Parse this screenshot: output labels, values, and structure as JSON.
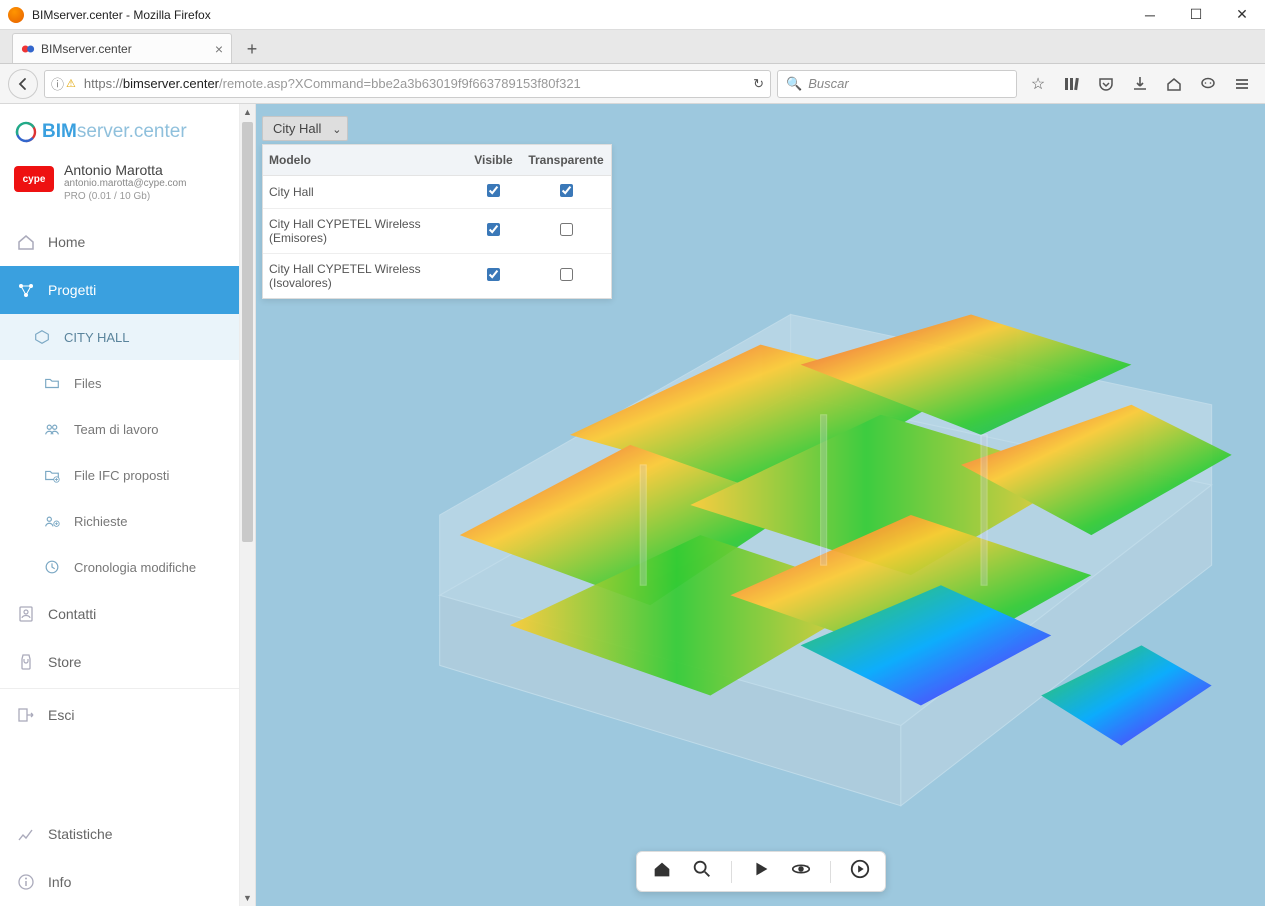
{
  "window": {
    "title": "BIMserver.center - Mozilla Firefox"
  },
  "tab": {
    "label": "BIMserver.center"
  },
  "address": {
    "scheme": "https://",
    "host": "bimserver.center",
    "path": "/remote.asp?XCommand=bbe2a3b63019f9f663789153f80f321"
  },
  "search": {
    "placeholder": "Buscar"
  },
  "brand": {
    "bold": "BIM",
    "rest": "server.center"
  },
  "user": {
    "badge": "cype",
    "name": "Antonio Marotta",
    "email": "antonio.marotta@cype.com",
    "plan": "PRO (0.01 / 10 Gb)"
  },
  "nav": {
    "home": "Home",
    "progetti": "Progetti",
    "project": "CITY HALL",
    "files": "Files",
    "team": "Team di lavoro",
    "ifc": "File IFC proposti",
    "richieste": "Richieste",
    "crono": "Cronologia modifiche",
    "contatti": "Contatti",
    "store": "Store",
    "esci": "Esci",
    "stat": "Statistiche",
    "info": "Info"
  },
  "dropdown": {
    "label": "City Hall"
  },
  "panel": {
    "headers": {
      "modelo": "Modelo",
      "visible": "Visible",
      "trans": "Transparente"
    },
    "rows": [
      {
        "name": "City Hall",
        "visible": true,
        "trans": true
      },
      {
        "name": "City Hall CYPETEL Wireless (Emisores)",
        "visible": true,
        "trans": false
      },
      {
        "name": "City Hall CYPETEL Wireless (Isovalores)",
        "visible": true,
        "trans": false
      }
    ]
  }
}
